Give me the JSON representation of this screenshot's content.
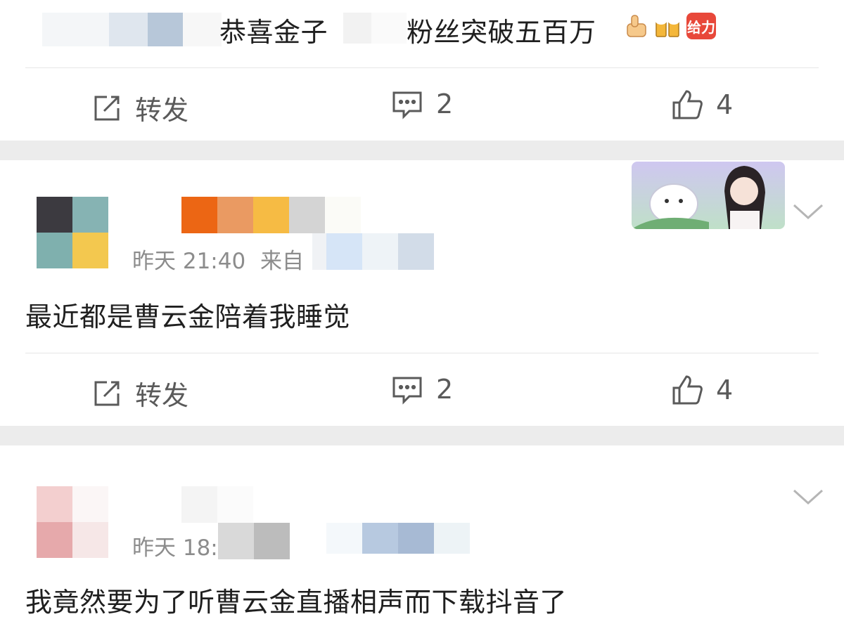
{
  "posts": [
    {
      "text_visible": "恭喜金子",
      "text_visible_end": "粉丝突破五百万",
      "emoji_names": [
        "thumbs-up-icon",
        "cheers-icon",
        "gift-badge-icon"
      ],
      "gift_label": "给力",
      "repost_label": "转发",
      "comment_count": "2",
      "like_count": "4"
    },
    {
      "time": "昨天 21:40",
      "source_prefix": "来自",
      "text": "最近都是曹云金陪着我睡觉",
      "repost_label": "转发",
      "comment_count": "2",
      "like_count": "4"
    },
    {
      "time": "昨天 18:38",
      "text": "我竟然要为了听曹云金直播相声而下载抖音了"
    }
  ],
  "colors": {
    "divider": "#e6e6e6",
    "gap": "#ececec",
    "meta": "#8c8c8c",
    "action": "#5a5a5a"
  }
}
